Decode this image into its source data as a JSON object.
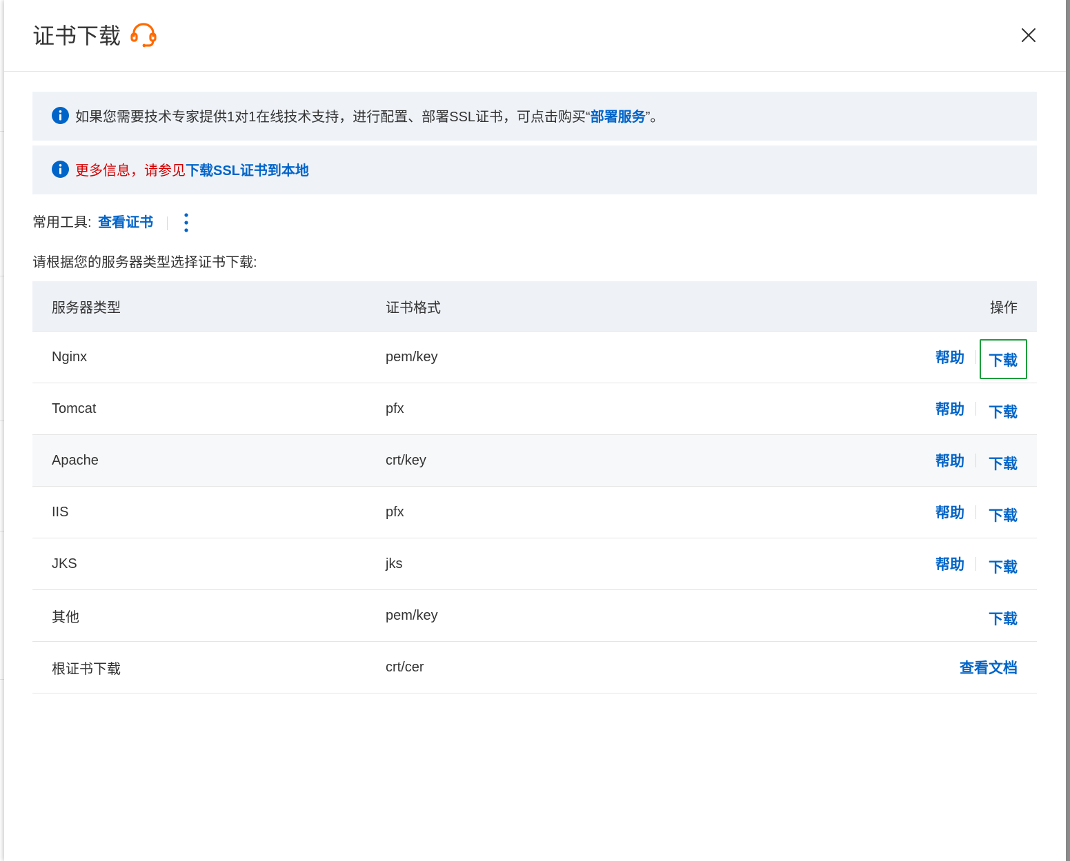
{
  "drawer": {
    "title": "证书下载"
  },
  "notices": [
    {
      "text_before": "如果您需要技术专家提供1对1在线技术支持，进行配置、部署SSL证书，可点击购买“",
      "link": "部署服务",
      "text_after": "”。"
    },
    {
      "text_before": "更多信息，请参见",
      "link": "下载SSL证书到本地"
    }
  ],
  "tools": {
    "label": "常用工具:",
    "view_cert": "查看证书"
  },
  "instruction": "请根据您的服务器类型选择证书下载:",
  "table": {
    "headers": [
      "服务器类型",
      "证书格式",
      "操作"
    ],
    "rows": [
      {
        "server": "Nginx",
        "format": "pem/key",
        "help": "帮助",
        "download": "下载"
      },
      {
        "server": "Tomcat",
        "format": "pfx",
        "help": "帮助",
        "download": "下载"
      },
      {
        "server": "Apache",
        "format": "crt/key",
        "help": "帮助",
        "download": "下载"
      },
      {
        "server": "IIS",
        "format": "pfx",
        "help": "帮助",
        "download": "下载"
      },
      {
        "server": "JKS",
        "format": "jks",
        "help": "帮助",
        "download": "下载"
      },
      {
        "server": "其他",
        "format": "pem/key",
        "download": "下载"
      },
      {
        "server": "根证书下载",
        "format": "crt/cer",
        "view_docs": "查看文档"
      }
    ]
  },
  "colors": {
    "link": "#0064c8",
    "notice_bg": "#eff3f8",
    "warning_text": "#d40000",
    "support_icon": "#ff6a00",
    "focus_outline": "#1a9e3a"
  },
  "icons": [
    "support-headset-icon",
    "close-icon",
    "info-icon",
    "more-vertical-icon"
  ]
}
